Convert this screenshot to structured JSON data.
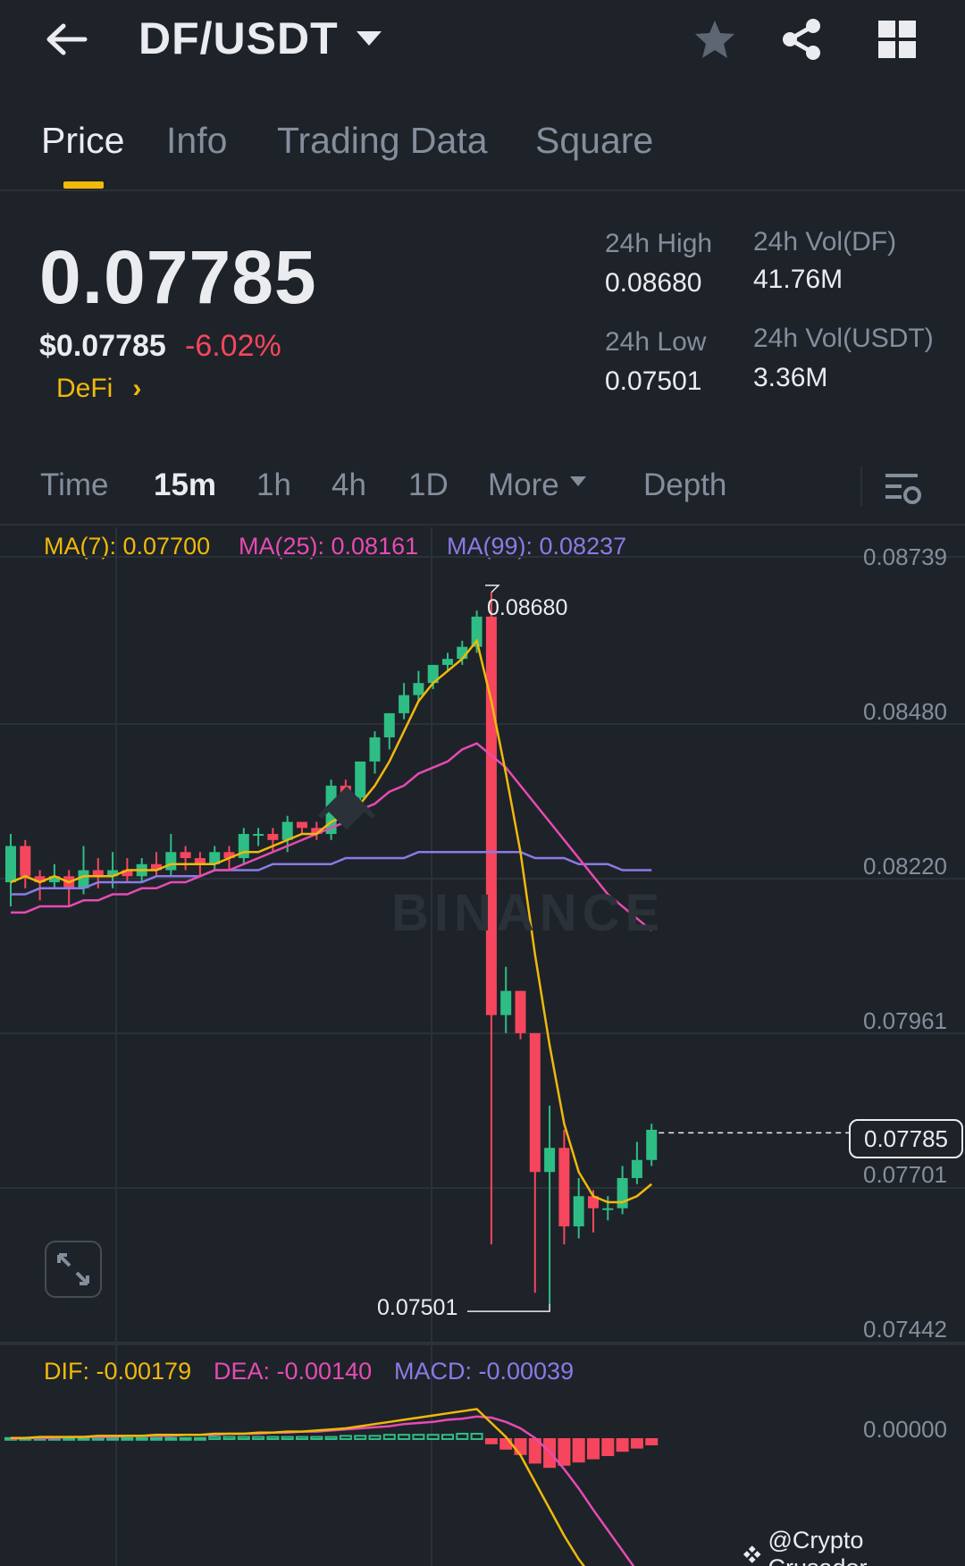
{
  "header": {
    "pair": "DF/USDT",
    "back_icon": "arrow-left-icon",
    "favorite_icon": "star-icon",
    "share_icon": "share-icon",
    "grid_icon": "grid-icon"
  },
  "tabs": [
    "Price",
    "Info",
    "Trading Data",
    "Square"
  ],
  "ticker": {
    "last_price": "0.07785",
    "usd_price": "$0.07785",
    "change": "-6.02%",
    "sector": "DeFi",
    "high_label": "24h High",
    "high_value": "0.08680",
    "low_label": "24h Low",
    "low_value": "0.07501",
    "vol_base_label": "24h Vol(DF)",
    "vol_base_value": "41.76M",
    "vol_quote_label": "24h Vol(USDT)",
    "vol_quote_value": "3.36M"
  },
  "intervals": {
    "items": [
      "Time",
      "15m",
      "1h",
      "4h",
      "1D",
      "More",
      "Depth"
    ],
    "active": "15m"
  },
  "indicators": {
    "ma7": "MA(7): 0.07700",
    "ma25": "MA(25): 0.08161",
    "ma99": "MA(99): 0.08237",
    "dif": "DIF: -0.00179",
    "dea": "DEA: -0.00140",
    "macd": "MACD: -0.00039"
  },
  "colors": {
    "up": "#2ebd85",
    "down": "#f6465d",
    "ma7": "#f0b90b",
    "ma25": "#e64bb3",
    "ma99": "#8c7ae6",
    "accent": "#f0b90b"
  },
  "chart_data": {
    "type": "candlestick",
    "y_axis_ticks": [
      "0.08739",
      "0.08480",
      "0.08220",
      "0.07961",
      "0.07701",
      "0.07442"
    ],
    "current_price": "0.07785",
    "high_marker": "0.08680",
    "low_marker": "0.07501",
    "macd_axis_ticks": [
      "0.00000"
    ],
    "candles": [
      [
        0.082,
        0.0826,
        0.0816,
        0.0828
      ],
      [
        0.0826,
        0.0821,
        0.0819,
        0.0827
      ],
      [
        0.0821,
        0.082,
        0.0817,
        0.0822
      ],
      [
        0.082,
        0.0821,
        0.0819,
        0.0823
      ],
      [
        0.0821,
        0.0819,
        0.0816,
        0.0822
      ],
      [
        0.0819,
        0.0822,
        0.0818,
        0.0826
      ],
      [
        0.0822,
        0.0821,
        0.0819,
        0.0824
      ],
      [
        0.0821,
        0.0822,
        0.0819,
        0.0825
      ],
      [
        0.0822,
        0.0821,
        0.082,
        0.0824
      ],
      [
        0.0821,
        0.0823,
        0.082,
        0.0824
      ],
      [
        0.0823,
        0.0822,
        0.0821,
        0.0825
      ],
      [
        0.0822,
        0.0825,
        0.0821,
        0.0828
      ],
      [
        0.0825,
        0.0824,
        0.0822,
        0.0826
      ],
      [
        0.0824,
        0.0823,
        0.0821,
        0.0825
      ],
      [
        0.0823,
        0.0825,
        0.0822,
        0.0826
      ],
      [
        0.0825,
        0.0824,
        0.0822,
        0.0826
      ],
      [
        0.0824,
        0.0828,
        0.0823,
        0.0829
      ],
      [
        0.0828,
        0.0828,
        0.0826,
        0.0829
      ],
      [
        0.0828,
        0.0827,
        0.0825,
        0.0829
      ],
      [
        0.0827,
        0.083,
        0.0825,
        0.0831
      ],
      [
        0.083,
        0.0829,
        0.0828,
        0.083
      ],
      [
        0.0829,
        0.0828,
        0.0827,
        0.083
      ],
      [
        0.0828,
        0.0836,
        0.0827,
        0.0837
      ],
      [
        0.0836,
        0.0834,
        0.0832,
        0.0837
      ],
      [
        0.0834,
        0.084,
        0.0833,
        0.084
      ],
      [
        0.084,
        0.0844,
        0.0838,
        0.0845
      ],
      [
        0.0844,
        0.0848,
        0.0842,
        0.0848
      ],
      [
        0.0848,
        0.0851,
        0.0847,
        0.0853
      ],
      [
        0.0851,
        0.0853,
        0.085,
        0.0855
      ],
      [
        0.0853,
        0.0856,
        0.0852,
        0.0856
      ],
      [
        0.0856,
        0.0857,
        0.0855,
        0.0858
      ],
      [
        0.0857,
        0.0859,
        0.0856,
        0.086
      ],
      [
        0.0859,
        0.0864,
        0.0858,
        0.0865
      ],
      [
        0.0864,
        0.0798,
        0.076,
        0.0868
      ],
      [
        0.0798,
        0.0802,
        0.0795,
        0.0806
      ],
      [
        0.0802,
        0.0795,
        0.0794,
        0.0802
      ],
      [
        0.0795,
        0.0772,
        0.0752,
        0.0795
      ],
      [
        0.0772,
        0.0776,
        0.075,
        0.0783
      ],
      [
        0.0776,
        0.0763,
        0.076,
        0.0779
      ],
      [
        0.0763,
        0.0768,
        0.0761,
        0.0771
      ],
      [
        0.0768,
        0.0766,
        0.0762,
        0.0769
      ],
      [
        0.0766,
        0.0766,
        0.0764,
        0.0768
      ],
      [
        0.0766,
        0.0771,
        0.0765,
        0.0773
      ],
      [
        0.0771,
        0.0774,
        0.077,
        0.0777
      ],
      [
        0.0774,
        0.0779,
        0.0773,
        0.078
      ]
    ],
    "ma7": [
      0.082,
      0.0821,
      0.082,
      0.0821,
      0.082,
      0.0821,
      0.0821,
      0.0821,
      0.0822,
      0.0822,
      0.0822,
      0.0823,
      0.0823,
      0.0823,
      0.0823,
      0.0824,
      0.0825,
      0.0825,
      0.0826,
      0.0827,
      0.0828,
      0.0828,
      0.083,
      0.0831,
      0.0833,
      0.0836,
      0.084,
      0.0845,
      0.085,
      0.0853,
      0.0855,
      0.0857,
      0.086,
      0.085,
      0.0838,
      0.0825,
      0.0808,
      0.0793,
      0.078,
      0.0772,
      0.0768,
      0.0767,
      0.0767,
      0.0768,
      0.077
    ],
    "ma25": [
      0.0815,
      0.0815,
      0.0816,
      0.0816,
      0.0816,
      0.0817,
      0.0817,
      0.0818,
      0.0818,
      0.0819,
      0.0819,
      0.082,
      0.082,
      0.0821,
      0.0822,
      0.0822,
      0.0823,
      0.0824,
      0.0825,
      0.0826,
      0.0827,
      0.0828,
      0.0829,
      0.083,
      0.0832,
      0.0833,
      0.0835,
      0.0836,
      0.0838,
      0.0839,
      0.084,
      0.0842,
      0.0843,
      0.0841,
      0.0839,
      0.0836,
      0.0833,
      0.083,
      0.0827,
      0.0824,
      0.0821,
      0.0818,
      0.0816,
      0.0814,
      0.0812
    ],
    "ma99": [
      0.0818,
      0.0818,
      0.0819,
      0.0819,
      0.0819,
      0.0819,
      0.082,
      0.082,
      0.082,
      0.082,
      0.0821,
      0.0821,
      0.0821,
      0.0821,
      0.0822,
      0.0822,
      0.0822,
      0.0822,
      0.0823,
      0.0823,
      0.0823,
      0.0823,
      0.0823,
      0.0824,
      0.0824,
      0.0824,
      0.0824,
      0.0824,
      0.0825,
      0.0825,
      0.0825,
      0.0825,
      0.0825,
      0.0825,
      0.0825,
      0.0825,
      0.0824,
      0.0824,
      0.0824,
      0.0823,
      0.0823,
      0.0823,
      0.0822,
      0.0822,
      0.0822
    ],
    "macd_hist": [
      1e-05,
      1e-05,
      1e-05,
      1e-05,
      1e-05,
      1e-05,
      1e-05,
      1e-05,
      1e-05,
      1e-05,
      1e-05,
      1e-05,
      1e-05,
      1e-05,
      2e-05,
      2e-05,
      2e-05,
      2e-05,
      2e-05,
      2e-05,
      2e-05,
      2e-05,
      2e-05,
      3e-05,
      3e-05,
      3e-05,
      4e-05,
      4e-05,
      4e-05,
      4e-05,
      4e-05,
      5e-05,
      5e-05,
      -4e-05,
      -9e-05,
      -0.00014,
      -0.00022,
      -0.00026,
      -0.00024,
      -0.00021,
      -0.00018,
      -0.00015,
      -0.00011,
      -8e-05,
      -5e-05
    ],
    "dif": [
      1e-05,
      1e-05,
      2e-05,
      2e-05,
      2e-05,
      2e-05,
      3e-05,
      3e-05,
      3e-05,
      3e-05,
      4e-05,
      4e-05,
      4e-05,
      4e-05,
      5e-05,
      5e-05,
      5e-05,
      6e-05,
      6e-05,
      7e-05,
      7e-05,
      8e-05,
      9e-05,
      0.0001,
      0.00012,
      0.00014,
      0.00016,
      0.00018,
      0.0002,
      0.00022,
      0.00024,
      0.00026,
      0.00028,
      0.00015,
      2e-05,
      -0.00015,
      -0.0004,
      -0.00065,
      -0.0009,
      -0.00112,
      -0.0013,
      -0.00145,
      -0.00158,
      -0.0017,
      -0.00179
    ],
    "dea": [
      0.0,
      1e-05,
      1e-05,
      1e-05,
      2e-05,
      2e-05,
      2e-05,
      2e-05,
      3e-05,
      3e-05,
      3e-05,
      3e-05,
      4e-05,
      4e-05,
      4e-05,
      5e-05,
      5e-05,
      5e-05,
      6e-05,
      6e-05,
      7e-05,
      7e-05,
      8e-05,
      9e-05,
      0.0001,
      0.00011,
      0.00012,
      0.00014,
      0.00015,
      0.00016,
      0.00018,
      0.00019,
      0.00021,
      0.0002,
      0.00016,
      0.0001,
      1e-05,
      -0.00012,
      -0.00028,
      -0.00046,
      -0.00066,
      -0.00085,
      -0.00104,
      -0.00123,
      -0.0014
    ]
  },
  "chart_labels": {
    "watermark": "BINANCE",
    "credit": "@Crypto Crusador"
  }
}
